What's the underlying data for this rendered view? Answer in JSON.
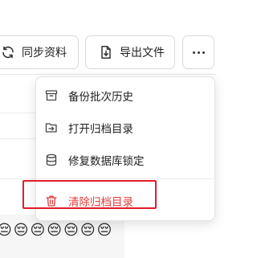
{
  "toolbar": {
    "sync_label": "同步资料",
    "export_label": "导出文件",
    "more_label": "···"
  },
  "menu": {
    "items": [
      {
        "label": "备份批次历史",
        "icon": "archive-icon"
      },
      {
        "label": "打开归档目录",
        "icon": "folder-open-icon"
      },
      {
        "label": "修复数据库锁定",
        "icon": "database-icon"
      },
      {
        "label": "清除归档目录",
        "icon": "trash-icon",
        "color": "#e23b3b"
      }
    ]
  },
  "background": {
    "emoji": [
      "😔",
      "😔",
      "😔",
      "😔",
      "😔",
      "😔",
      "😔"
    ]
  },
  "colors": {
    "danger": "#e23b3b",
    "highlight": "#e11d2a",
    "border": "#d9d9d9"
  }
}
